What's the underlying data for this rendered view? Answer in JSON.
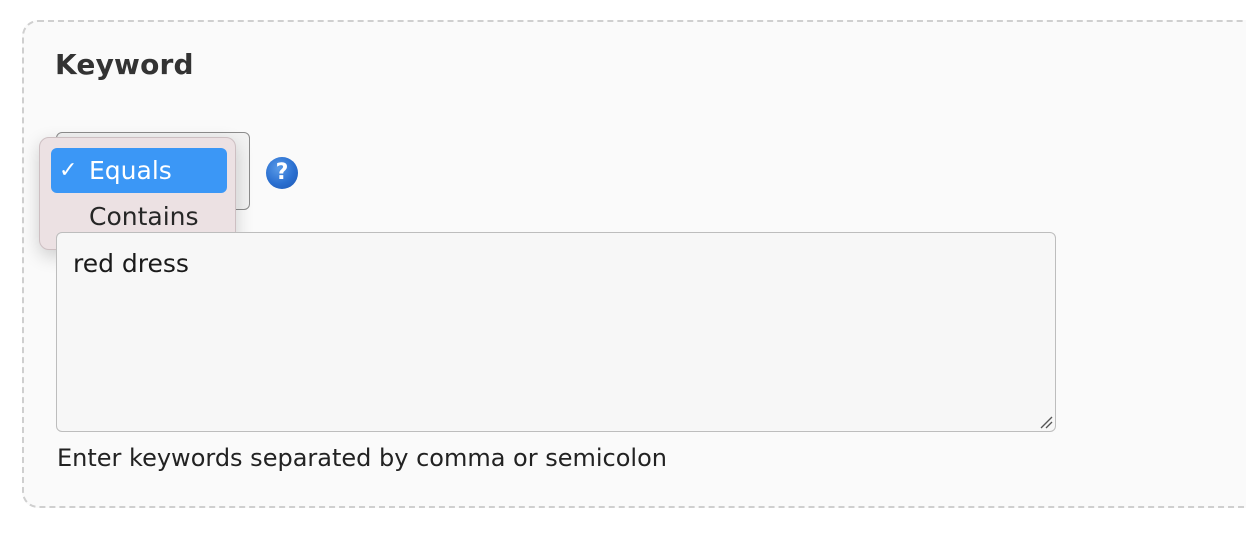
{
  "section": {
    "title": "Keyword"
  },
  "match_select": {
    "options": [
      {
        "label": "Equals",
        "selected": true,
        "check": "✓"
      },
      {
        "label": "Contains",
        "selected": false
      }
    ],
    "selected_value": "Equals"
  },
  "help": {
    "icon": "question-circle-icon",
    "glyph": "?",
    "color": "#2a6fd0"
  },
  "keywords": {
    "value": "red dress",
    "hint": "Enter keywords separated by comma or semicolon"
  },
  "colors": {
    "selection": "#3b97f6",
    "menu_bg": "#ece1e3",
    "panel_border": "#cfcfcf"
  }
}
